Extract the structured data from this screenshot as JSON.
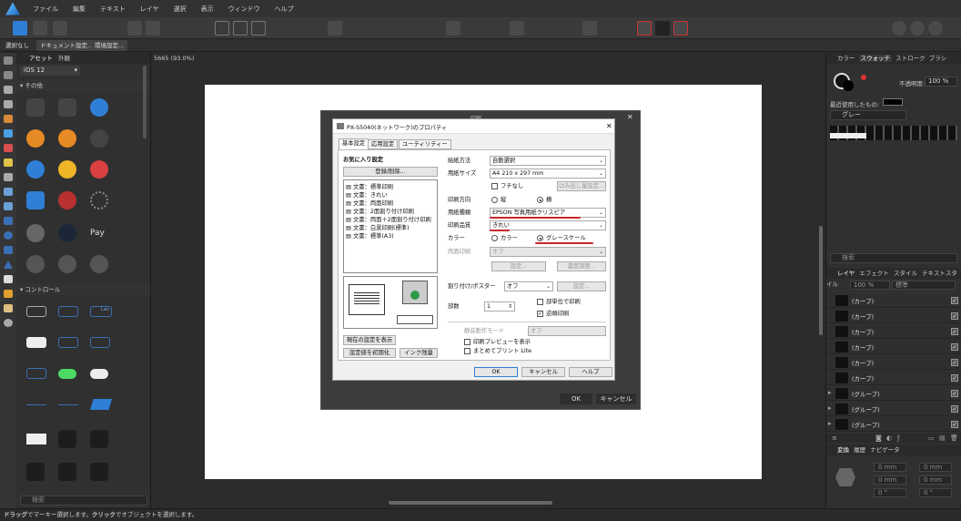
{
  "menu": [
    "ファイル",
    "編集",
    "テキスト",
    "レイヤ",
    "選択",
    "表示",
    "ウィンドウ",
    "ヘルプ"
  ],
  "context_bar": {
    "deselect": "選択なし",
    "doc_settings": "ドキュメント設定...",
    "env_settings": "環境設定..."
  },
  "assets_panel": {
    "tabs": [
      "アセット",
      "外観"
    ],
    "preset": "iOS 12",
    "section1": "その他",
    "section2": "コントロール",
    "search_placeholder": "検索",
    "control_label": "Lan"
  },
  "canvas": {
    "doc_tab": "5665 (93.0%)",
    "bg_title": "印刷",
    "bg_ok": "OK",
    "bg_cancel": "キャンセル"
  },
  "dialog": {
    "title": "PX-S5040(ネットワーク)のプロパティ",
    "tabs": [
      "基本設定",
      "応用設定",
      "ユーティリティー"
    ],
    "favorites_label": "お気に入り設定",
    "register_button": "登録/削除...",
    "favorites": [
      "文書：標準印刷",
      "文書：きれい",
      "文書：両面印刷",
      "文書：2面割り付け印刷",
      "文書：両面＋2面割り付け印刷",
      "文書：白黒印刷(標準)",
      "文書：標準(A3)"
    ],
    "show_current": "現在の設定を表示",
    "reset_defaults": "設定値を初期化",
    "ink_level": "インク残量",
    "feed_label": "給紙方法",
    "feed_value": "自動選択",
    "size_label": "用紙サイズ",
    "size_value": "A4 210 x 297 mm",
    "borderless": "フチなし",
    "overflow_button": "はみ出し量設定...",
    "orient_label": "印刷方向",
    "portrait": "縦",
    "landscape": "横",
    "paper_label": "用紙種類",
    "paper_value": "EPSON 写真用紙クリスピア",
    "quality_label": "印刷品質",
    "quality_value": "きれい",
    "color_label": "カラー",
    "color_opt": "カラー",
    "gray_opt": "グレースケール",
    "duplex_label": "両面印刷",
    "duplex_value": "オフ",
    "settings_button": "設定...",
    "density_button": "濃度調整...",
    "layout_label": "割り付け/ポスター",
    "layout_value": "オフ",
    "layout_settings": "設定...",
    "copies_label": "部数",
    "copies_value": "1",
    "collate": "部単位で印刷",
    "reverse": "逆順印刷",
    "quiet_label": "静音動作モード",
    "quiet_value": "オフ",
    "preview": "印刷プレビューを表示",
    "lite": "まとめてプリント Lite",
    "ok": "OK",
    "cancel": "キャンセル",
    "help": "ヘルプ"
  },
  "right_panel": {
    "top_tabs": [
      "カラー",
      "スウォッチ",
      "ストローク",
      "ブラシ"
    ],
    "opacity_label": "不透明度:",
    "opacity_value": "100 %",
    "recent": "最近使用したもの:",
    "palette": "グレー",
    "search_placeholder": "検索",
    "layer_tabs": [
      "レイヤ",
      "エフェクト",
      "スタイル",
      "テキストスタイル"
    ],
    "blend_opacity": "100 %",
    "blend_mode": "標準",
    "layers": [
      "(カーブ)",
      "(カーブ)",
      "(カーブ)",
      "(カーブ)",
      "(カーブ)",
      "(カーブ)",
      "(グループ)",
      "(グループ)",
      "(グループ)"
    ],
    "transform_tabs": [
      "変換",
      "履歴",
      "ナビゲータ"
    ],
    "transform_values": [
      "0 mm",
      "0 mm",
      "0 mm",
      "0 mm",
      "0 °",
      "0 °"
    ]
  },
  "status": {
    "drag": "ドラッグ",
    "text1": "でマーキー選択します。",
    "click": "クリック",
    "text2": "でオブジェクトを選択します。"
  },
  "colors": {
    "accent": "#3b6fb5",
    "annotation": "#c62828"
  }
}
